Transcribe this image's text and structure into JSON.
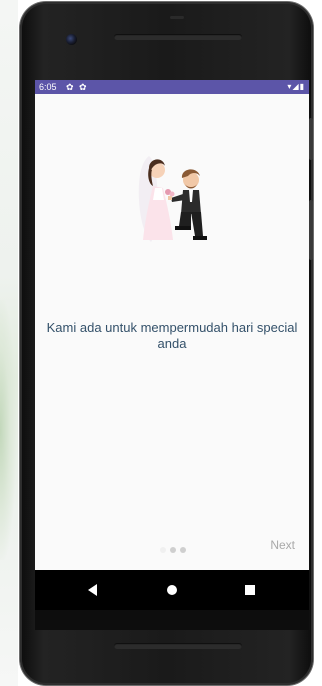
{
  "status_bar": {
    "time": "6:05",
    "settings_icon": "gear-icon",
    "right_icons": "▾◢▮",
    "background_color": "#5c55a8"
  },
  "onboarding": {
    "illustration_icon": "wedding-couple-illustration",
    "message": "Kami ada untuk mempermudah hari special anda",
    "page_indicator": {
      "total_pages": 3,
      "current_page": 1,
      "active_color": "#f0f0f0",
      "inactive_color": "#cfcfcf"
    },
    "next_label": "Next"
  },
  "nav_bar": {
    "back_icon": "back-triangle-icon",
    "home_icon": "home-circle-icon",
    "recents_icon": "recents-square-icon"
  }
}
